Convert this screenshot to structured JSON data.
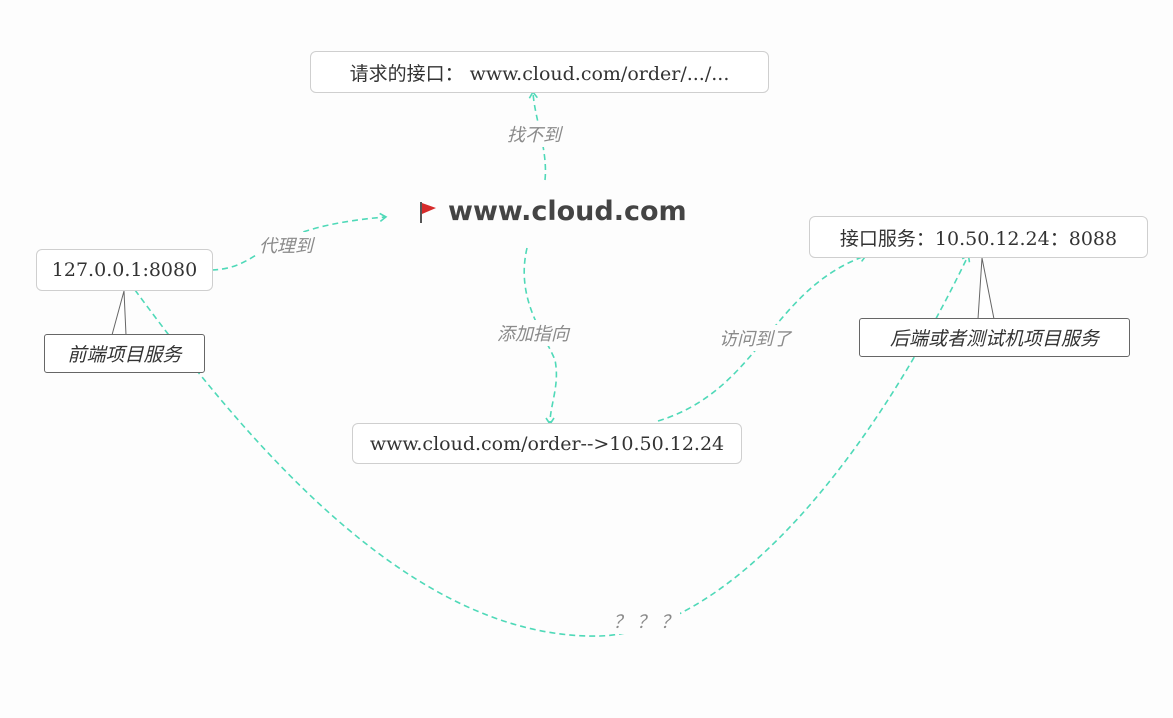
{
  "central_topic": {
    "label": "www.cloud.com",
    "icon": "flag-icon",
    "flag_color": "#d62b2b"
  },
  "nodes": {
    "requested_api": "请求的接口： www.cloud.com/order/.../...",
    "local_frontend": "127.0.0.1:8080",
    "api_service": "接口服务：10.50.12.24：8088",
    "host_mapping": "www.cloud.com/order-->10.50.12.24"
  },
  "notes": {
    "frontend_project": "前端项目服务",
    "backend_project": "后端或者测试机项目服务"
  },
  "edge_labels": {
    "not_found": "找不到",
    "proxy_to": "代理到",
    "add_pointer": "添加指向",
    "accessed": "访问到了",
    "unknown": "？ ？ ？"
  },
  "colors": {
    "connector": "#4fd9b8",
    "node_border": "#cfcfcf",
    "note_border": "#666666",
    "label_text": "#8a8a8a"
  }
}
